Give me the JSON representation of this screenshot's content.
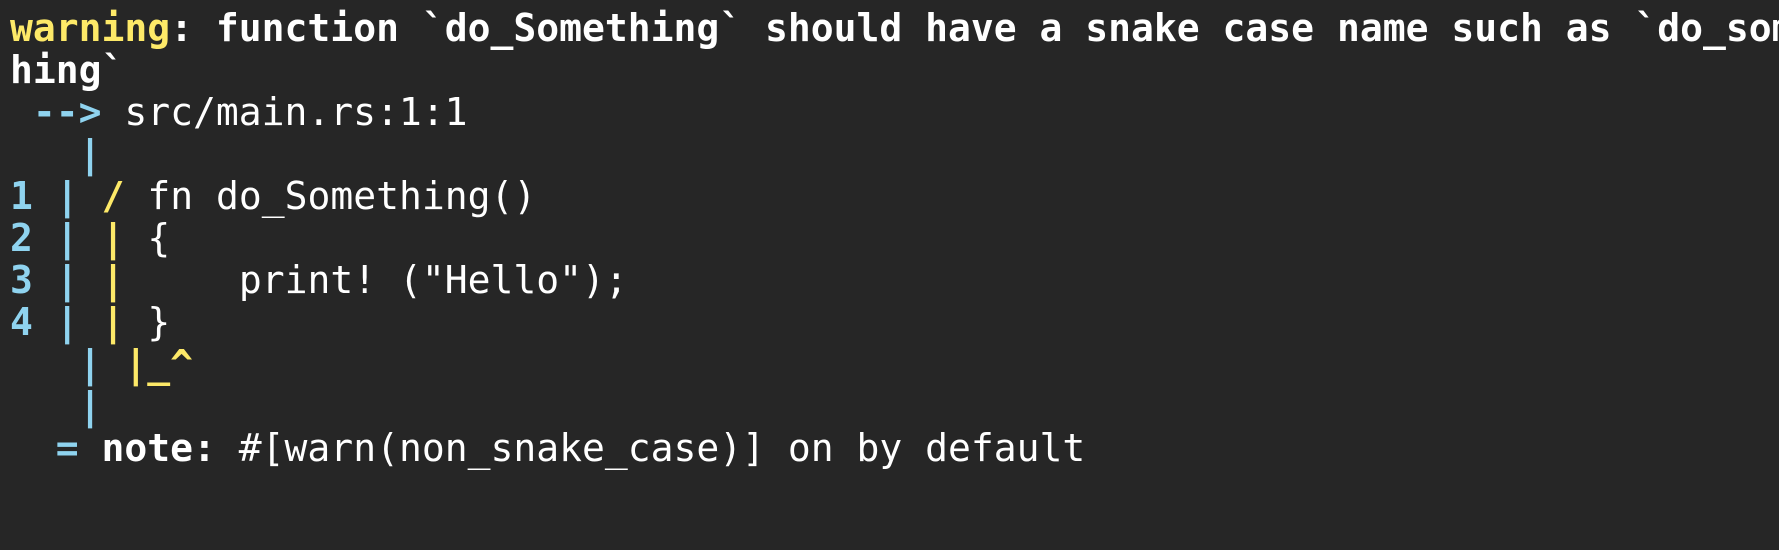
{
  "terminal": {
    "warning_label": "warning",
    "warning_sep": ": ",
    "warning_message_1": "function `do_Something` should have a snake case name such as `do_somet",
    "warning_message_2": "hing`",
    "location": {
      "arrow": " --> ",
      "path": "src/main.rs:1:1"
    },
    "gutter_bar": "|",
    "gutter_prefix_empty": "   ",
    "code_lines": [
      {
        "number": "1",
        "marker": "/",
        "code": " fn do_Something()"
      },
      {
        "number": "2",
        "marker": "|",
        "code": " {"
      },
      {
        "number": "3",
        "marker": "|",
        "code": "     print! (\"Hello\");"
      },
      {
        "number": "4",
        "marker": "|",
        "code": " }"
      }
    ],
    "underline_marker": "|_^",
    "note": {
      "equals": "  = ",
      "label": "note",
      "colon": ":",
      "text": " #[warn(non_snake_case)] on by default"
    },
    "colors": {
      "background": "#262626",
      "warning": "#fde968",
      "gutter": "#8fd3ef",
      "text": "#ffffff"
    }
  }
}
